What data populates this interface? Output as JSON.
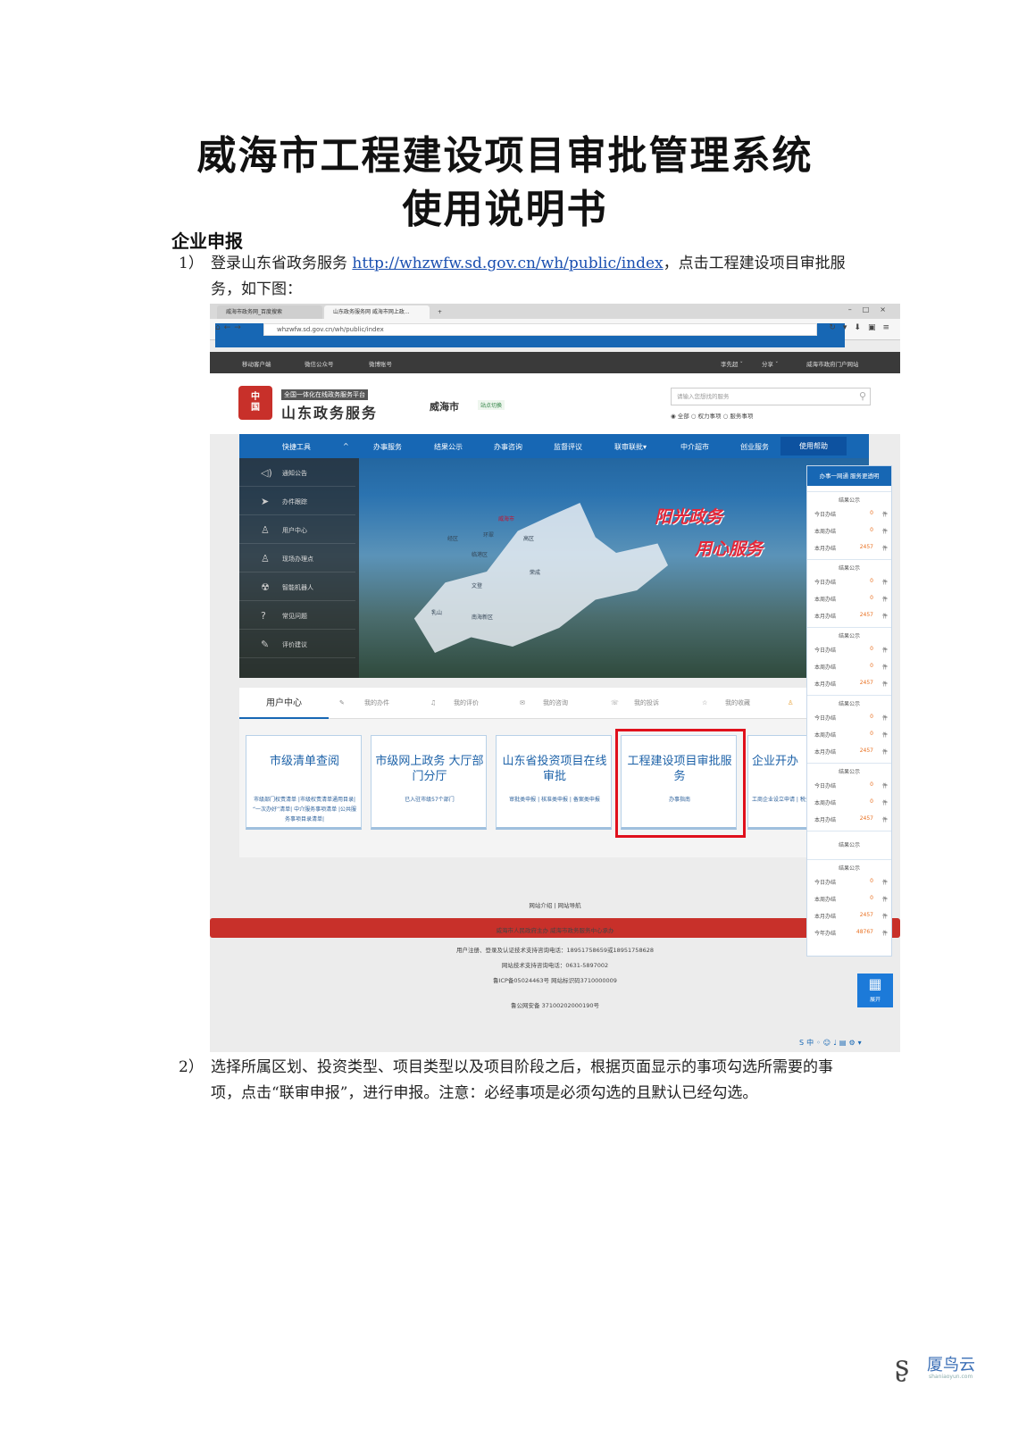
{
  "doc": {
    "title_line1": "威海市工程建设项目审批管理系统",
    "title_line2": "使用说明书",
    "section": "企业申报",
    "p1_num": "1）",
    "p1_pre": "登录山东省政务服务 ",
    "p1_link": "http://whzwfw.sd.gov.cn/wh/public/index",
    "p1_post": "，点击工程建设项目审批服务，如下图：",
    "p2_num": "2）",
    "p2_text": "选择所属区划、投资类型、项目类型以及项目阶段之后，根据页面显示的事项勾选所需要的事项，点击“联审申报”，进行申报。注意：必经事项是必须勾选的且默认已经勾选。"
  },
  "browser": {
    "tab1": "威海市政务网_百度搜索",
    "tab2": "山东政务服务网 威海市网上政...",
    "address": "whzwfw.sd.gov.cn/wh/public/index"
  },
  "site": {
    "topbar": [
      "移动客户端",
      "微信公众号",
      "微博账号"
    ],
    "topbar_right": [
      "李先超 ˇ",
      "分享 ˇ",
      "威海市政府门户网站"
    ],
    "platform_sub": "全国一体化在线政务服务平台",
    "platform_name": "山东政务服务",
    "city": "威海市",
    "city_switch": "站点切换",
    "search_placeholder": "请输入您想找的服务",
    "search_scope": "◉ 全部   ○ 权力事项   ○ 服务事项",
    "nav": [
      "快捷工具",
      "办事服务",
      "结果公示",
      "办事咨询",
      "监督评议",
      "联审联批▾",
      "中介超市",
      "创业服务"
    ],
    "nav_help": "使用帮助",
    "quick_tools": [
      {
        "icon": "◁)",
        "label": "通知公告"
      },
      {
        "icon": "➤",
        "label": "办件跟踪"
      },
      {
        "icon": "♙",
        "label": "用户中心"
      },
      {
        "icon": "♙",
        "label": "现场办理点"
      },
      {
        "icon": "☢",
        "label": "智能机器人"
      },
      {
        "icon": "?",
        "label": "常见问题"
      },
      {
        "icon": "✎",
        "label": "评价建议"
      }
    ],
    "map_labels": [
      "威海市",
      "环翠",
      "高区",
      "临港区",
      "经区",
      "荣成",
      "文登",
      "乳山",
      "南海新区"
    ],
    "slogan1": "阳光政务",
    "slogan2": "用心服务",
    "right_header": "办事一网通  服务更透明",
    "result_title": "结果公示",
    "rows": [
      {
        "name": "今日办结",
        "value": "0",
        "unit": "件"
      },
      {
        "name": "本周办结",
        "value": "0",
        "unit": "件"
      },
      {
        "name": "本月办结",
        "value": "2457",
        "unit": "件"
      },
      {
        "name": "今年办结",
        "value": "48767",
        "unit": "件"
      }
    ],
    "user_tabs": [
      "用户中心",
      "我的办件",
      "我的评价",
      "我的咨询",
      "我的投诉",
      "我的收藏"
    ],
    "cards": [
      {
        "title": "市级清单查阅",
        "sub": "市级部门权责清单 |市级权责清单通用目录| “一次办好”清单| 中介服务事项清单 |公共服务事项目录清单|"
      },
      {
        "title": "市级网上政务 大厅部门分厅",
        "sub": "已入驻市级57个部门"
      },
      {
        "title": "山东省投资项目在线审批",
        "sub": "审批类申报 | 核准类申报 | 备案类申报"
      },
      {
        "title": "工程建设项目审批服务",
        "sub": "办事指南"
      },
      {
        "title": "企业开办",
        "sub": "工商企业设立申请 | 税企业设立申请"
      }
    ],
    "footer_links": "网站介绍  |  网站导航",
    "footer_host": "威海市人民政府主办  威海市政务服务中心承办",
    "footer_support": "用户注册、登录及认证技术支持咨询电话：18951758659或18951758628",
    "footer_tech": "网站技术支持咨询电话：0631-5897002",
    "footer_icp": "鲁ICP备05024463号    网站标识码3710000009",
    "footer_police": "鲁公网安备 37100202000190号",
    "expand": "展开"
  },
  "watermark": {
    "name": "厦鸟云",
    "domain": "shaniaoyun.com"
  }
}
